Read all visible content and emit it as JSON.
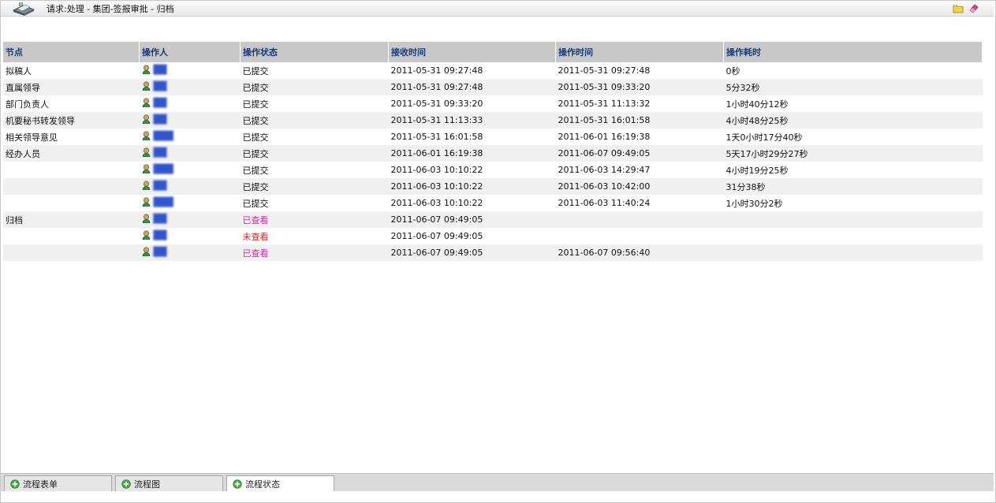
{
  "header": {
    "title": "请求:处理 - 集团-签报审批 - 归档",
    "icons": [
      "app-logo-icon",
      "folder-icon",
      "eraser-icon"
    ]
  },
  "table": {
    "columns": [
      "节点",
      "操作人",
      "操作状态",
      "接收时间",
      "操作时间",
      "操作耗时"
    ],
    "rows": [
      {
        "node": "拟稿人",
        "user": "██",
        "status": "已提交",
        "received": "2011-05-31 09:27:48",
        "operated": "2011-05-31 09:27:48",
        "duration": "0秒"
      },
      {
        "node": "直属领导",
        "user": "██",
        "status": "已提交",
        "received": "2011-05-31 09:27:48",
        "operated": "2011-05-31 09:33:20",
        "duration": "5分32秒"
      },
      {
        "node": "部门负责人",
        "user": "██",
        "status": "已提交",
        "received": "2011-05-31 09:33:20",
        "operated": "2011-05-31 11:13:32",
        "duration": "1小时40分12秒"
      },
      {
        "node": "机要秘书转发领导",
        "user": "██",
        "status": "已提交",
        "received": "2011-05-31 11:13:33",
        "operated": "2011-05-31 16:01:58",
        "duration": "4小时48分25秒"
      },
      {
        "node": "相关领导意见",
        "user": "███",
        "status": "已提交",
        "received": "2011-05-31 16:01:58",
        "operated": "2011-06-01 16:19:38",
        "duration": "1天0小时17分40秒"
      },
      {
        "node": "经办人员",
        "user": "██",
        "status": "已提交",
        "received": "2011-06-01 16:19:38",
        "operated": "2011-06-07 09:49:05",
        "duration": "5天17小时29分27秒"
      },
      {
        "node": "",
        "user": "███",
        "status": "已提交",
        "received": "2011-06-03 10:10:22",
        "operated": "2011-06-03 14:29:47",
        "duration": "4小时19分25秒"
      },
      {
        "node": "",
        "user": "██",
        "status": "已提交",
        "received": "2011-06-03 10:10:22",
        "operated": "2011-06-03 10:42:00",
        "duration": "31分38秒"
      },
      {
        "node": "",
        "user": "███",
        "status": "已提交",
        "received": "2011-06-03 10:10:22",
        "operated": "2011-06-03 11:40:24",
        "duration": "1小时30分2秒"
      },
      {
        "node": "归档",
        "user": "██",
        "status": "已查看",
        "received": "2011-06-07 09:49:05",
        "operated": "",
        "duration": ""
      },
      {
        "node": "",
        "user": "██",
        "status": "未查看",
        "received": "2011-06-07 09:49:05",
        "operated": "",
        "duration": ""
      },
      {
        "node": "",
        "user": "██",
        "status": "已查看",
        "received": "2011-06-07 09:49:05",
        "operated": "2011-06-07 09:56:40",
        "duration": ""
      }
    ]
  },
  "tabs": [
    {
      "label": "流程表单",
      "active": false
    },
    {
      "label": "流程图",
      "active": false
    },
    {
      "label": "流程状态",
      "active": true
    }
  ],
  "colors": {
    "header_text": "#1a3a78",
    "viewed": "#e020b0",
    "unread": "#e02020",
    "link": "#3355cc"
  }
}
